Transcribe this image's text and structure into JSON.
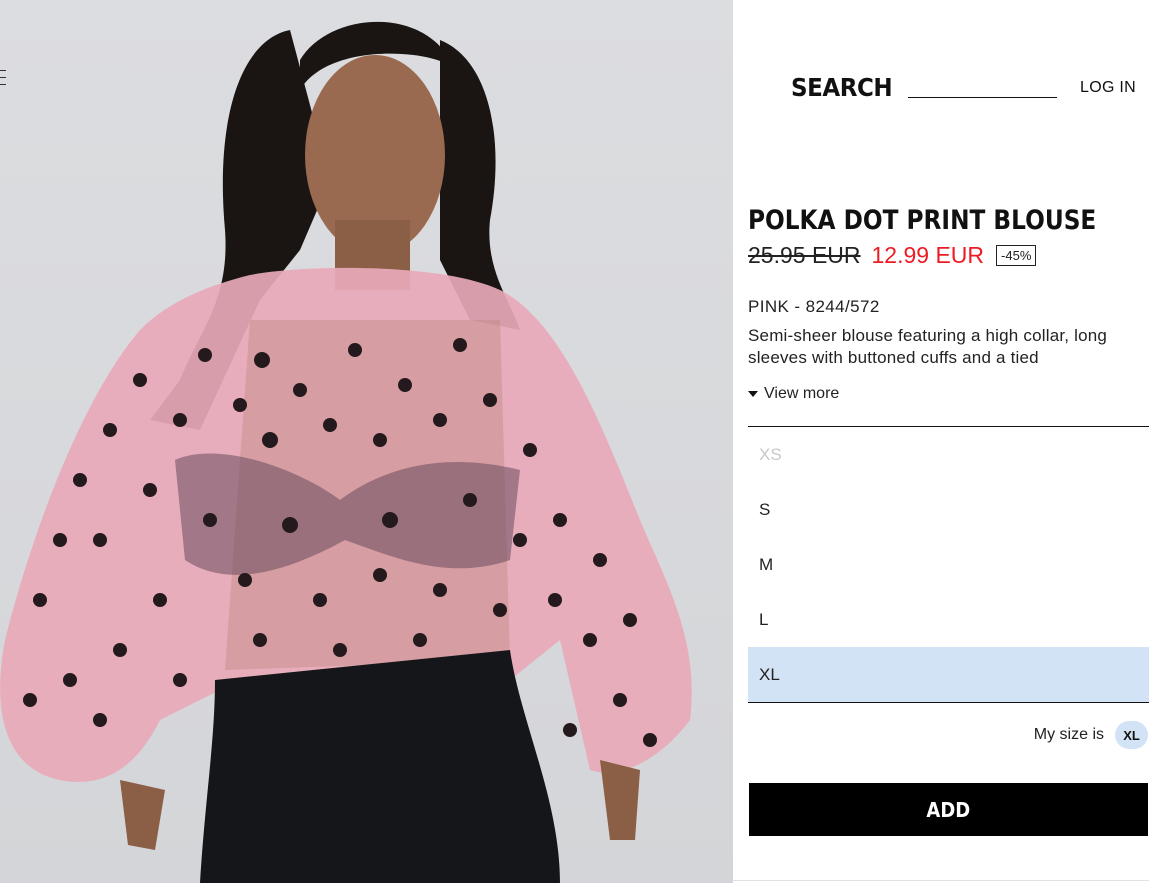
{
  "header": {
    "search_label": "SEARCH",
    "login_label": "LOG IN"
  },
  "product": {
    "title": "POLKA DOT PRINT BLOUSE",
    "old_price": "25.95 EUR",
    "new_price": "12.99 EUR",
    "discount": "-45%",
    "color_ref": "PINK - 8244/572",
    "description": "Semi-sheer blouse featuring a high collar, long sleeves with buttoned cuffs and a tied",
    "view_more": "View more"
  },
  "sizes": [
    {
      "label": "XS",
      "available": false,
      "selected": false
    },
    {
      "label": "S",
      "available": true,
      "selected": false
    },
    {
      "label": "M",
      "available": true,
      "selected": false
    },
    {
      "label": "L",
      "available": true,
      "selected": false
    },
    {
      "label": "XL",
      "available": true,
      "selected": true
    }
  ],
  "my_size": {
    "label": "My size is",
    "value": "XL"
  },
  "add_button": "ADD",
  "colors": {
    "sale_price": "#ec1c24",
    "selected_size_bg": "#d3e3f6",
    "button_bg": "#000000"
  },
  "icons": {
    "menu": "hamburger-menu-icon",
    "view_more": "caret-down-icon"
  }
}
